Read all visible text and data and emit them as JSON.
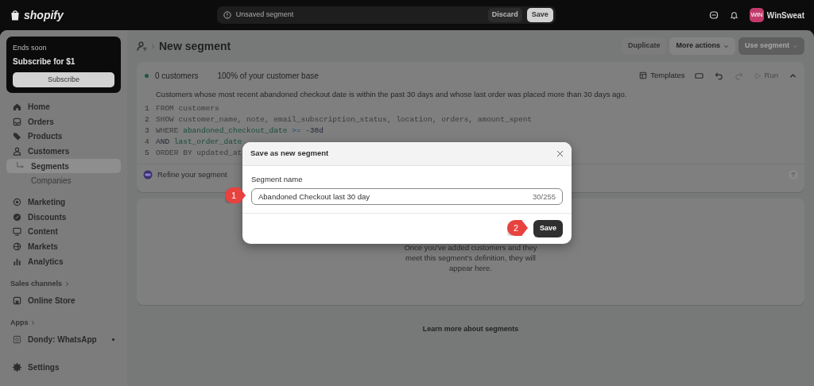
{
  "topbar": {
    "logo": "shopify",
    "notice": "Unsaved segment",
    "discard": "Discard",
    "save": "Save",
    "avatar": "WIN",
    "store": "WinSweat"
  },
  "promo": {
    "eyebrow": "Ends soon",
    "title": "Subscribe for $1",
    "button": "Subscribe"
  },
  "nav": [
    {
      "label": "Home",
      "selected": false
    },
    {
      "label": "Orders",
      "selected": false
    },
    {
      "label": "Products",
      "selected": false
    },
    {
      "label": "Customers",
      "selected": false,
      "children": [
        {
          "label": "Segments",
          "selected": true
        },
        {
          "label": "Companies",
          "selected": false
        }
      ]
    },
    {
      "label": "Marketing",
      "selected": false
    },
    {
      "label": "Discounts",
      "selected": false
    },
    {
      "label": "Content",
      "selected": false
    },
    {
      "label": "Markets",
      "selected": false
    },
    {
      "label": "Analytics",
      "selected": false
    }
  ],
  "sales_channels": {
    "heading": "Sales channels",
    "items": [
      {
        "label": "Online Store"
      }
    ]
  },
  "apps": {
    "heading": "Apps",
    "items": [
      {
        "label": "Dondy: WhatsApp"
      }
    ]
  },
  "settings": "Settings",
  "page": {
    "title": "New segment",
    "actions": [
      {
        "label": "Duplicate",
        "kind": "plain",
        "disabled": true
      },
      {
        "label": "More actions",
        "kind": "menu",
        "disabled": false
      },
      {
        "label": "Use segment",
        "kind": "menu",
        "disabled": true
      }
    ]
  },
  "editor": {
    "count": "0 customers",
    "share": "100% of your customer base",
    "templates": "Templates",
    "run": "Run",
    "description": "Customers whose most recent abandoned checkout date is within the past 30 days and whose last order was placed more than 30 days ago.",
    "lines": [
      {
        "num": "1",
        "tokens": [
          {
            "text": "FROM customers",
            "kind": "keyword"
          }
        ]
      },
      {
        "num": "2",
        "tokens": [
          {
            "text": "SHOW customer_name, note, email_subscription_status, location, orders, amount_spent",
            "kind": "keyword"
          }
        ]
      },
      {
        "num": "3",
        "tokens": [
          {
            "text": "WHERE",
            "kind": "keyword"
          },
          {
            "text": "abandoned_checkout_date",
            "kind": "field"
          },
          {
            "text": ">=",
            "kind": "operator"
          },
          {
            "text": "-30d",
            "kind": "value"
          }
        ]
      },
      {
        "num": "4",
        "tokens": [
          {
            "text": "AND",
            "kind": "value"
          },
          {
            "text": "last_order_date",
            "kind": "field"
          }
        ]
      },
      {
        "num": "5",
        "tokens": [
          {
            "text": "ORDER BY updated_at",
            "kind": "keyword"
          }
        ]
      }
    ],
    "refine": "Refine your segment"
  },
  "empty": {
    "text": "Once you've added customers and they meet this segment's definition, they will appear here."
  },
  "learn_more": "Learn more about segments",
  "modal": {
    "title": "Save as new segment",
    "field_label": "Segment name",
    "value": "Abandoned Checkout last 30 day",
    "counter": "30/255",
    "save": "Save"
  },
  "annotations": [
    "1",
    "2"
  ]
}
